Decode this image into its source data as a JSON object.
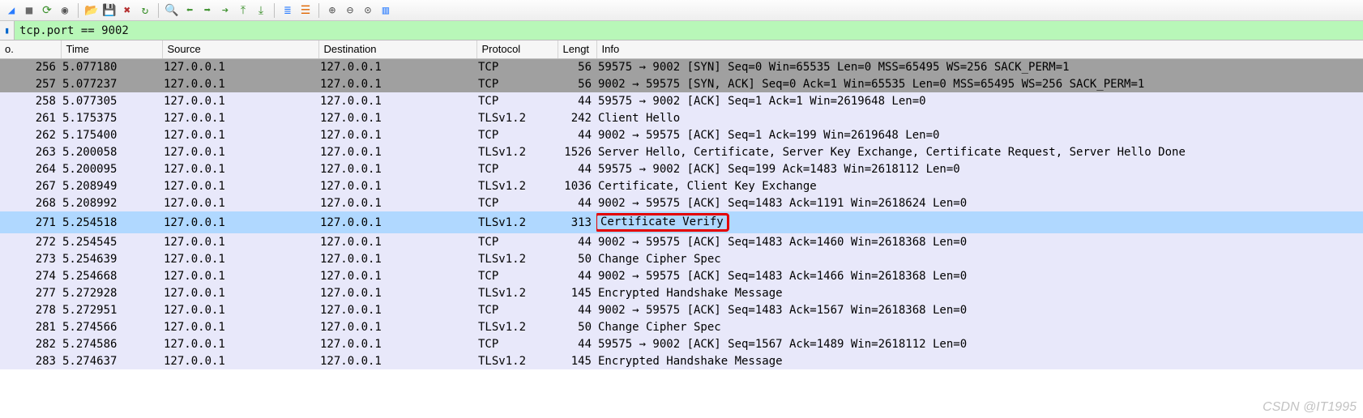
{
  "filter": {
    "value": "tcp.port == 9002",
    "bookmark_glyph": "▮"
  },
  "toolbar_icons": [
    {
      "name": "start-capture-icon",
      "glyph": "◢",
      "color": "#2a7cff"
    },
    {
      "name": "stop-capture-icon",
      "glyph": "■",
      "color": "#6a6a6a"
    },
    {
      "name": "restart-capture-icon",
      "glyph": "⟳",
      "color": "#3a8f2a"
    },
    {
      "name": "options-icon",
      "glyph": "◉",
      "color": "#555"
    },
    {
      "name": "sep"
    },
    {
      "name": "open-file-icon",
      "glyph": "📂",
      "color": "#caa012"
    },
    {
      "name": "save-file-icon",
      "glyph": "💾",
      "color": "#3260b4"
    },
    {
      "name": "close-file-icon",
      "glyph": "✖",
      "color": "#b53030"
    },
    {
      "name": "reload-icon",
      "glyph": "↻",
      "color": "#3a8f2a"
    },
    {
      "name": "sep"
    },
    {
      "name": "find-packet-icon",
      "glyph": "🔍",
      "color": "#555"
    },
    {
      "name": "go-back-icon",
      "glyph": "⬅",
      "color": "#3a8f2a"
    },
    {
      "name": "go-forward-icon",
      "glyph": "➡",
      "color": "#3a8f2a"
    },
    {
      "name": "goto-packet-icon",
      "glyph": "➔",
      "color": "#3a8f2a"
    },
    {
      "name": "first-packet-icon",
      "glyph": "⤒",
      "color": "#3a8f2a"
    },
    {
      "name": "last-packet-icon",
      "glyph": "⤓",
      "color": "#3a8f2a"
    },
    {
      "name": "sep"
    },
    {
      "name": "auto-scroll-icon",
      "glyph": "≣",
      "color": "#2a7cff"
    },
    {
      "name": "colorize-icon",
      "glyph": "☰",
      "color": "#e06500"
    },
    {
      "name": "sep"
    },
    {
      "name": "zoom-in-icon",
      "glyph": "⊕",
      "color": "#555"
    },
    {
      "name": "zoom-out-icon",
      "glyph": "⊖",
      "color": "#555"
    },
    {
      "name": "zoom-reset-icon",
      "glyph": "⊙",
      "color": "#555"
    },
    {
      "name": "resize-columns-icon",
      "glyph": "▥",
      "color": "#2a7cff"
    }
  ],
  "columns": [
    "o.",
    "Time",
    "Source",
    "Destination",
    "Protocol",
    "Lengt",
    "Info"
  ],
  "rows": [
    {
      "no": "256",
      "time": "5.077180",
      "src": "127.0.0.1",
      "dst": "127.0.0.1",
      "proto": "TCP",
      "len": "56",
      "info": "59575 → 9002 [SYN] Seq=0 Win=65535 Len=0 MSS=65495 WS=256 SACK_PERM=1",
      "cls": "syn"
    },
    {
      "no": "257",
      "time": "5.077237",
      "src": "127.0.0.1",
      "dst": "127.0.0.1",
      "proto": "TCP",
      "len": "56",
      "info": "9002 → 59575 [SYN, ACK] Seq=0 Ack=1 Win=65535 Len=0 MSS=65495 WS=256 SACK_PERM=1",
      "cls": "syn"
    },
    {
      "no": "258",
      "time": "5.077305",
      "src": "127.0.0.1",
      "dst": "127.0.0.1",
      "proto": "TCP",
      "len": "44",
      "info": "59575 → 9002 [ACK] Seq=1 Ack=1 Win=2619648 Len=0",
      "cls": "tcp"
    },
    {
      "no": "261",
      "time": "5.175375",
      "src": "127.0.0.1",
      "dst": "127.0.0.1",
      "proto": "TLSv1.2",
      "len": "242",
      "info": "Client Hello",
      "cls": "tcp"
    },
    {
      "no": "262",
      "time": "5.175400",
      "src": "127.0.0.1",
      "dst": "127.0.0.1",
      "proto": "TCP",
      "len": "44",
      "info": "9002 → 59575 [ACK] Seq=1 Ack=199 Win=2619648 Len=0",
      "cls": "tcp"
    },
    {
      "no": "263",
      "time": "5.200058",
      "src": "127.0.0.1",
      "dst": "127.0.0.1",
      "proto": "TLSv1.2",
      "len": "1526",
      "info": "Server Hello, Certificate, Server Key Exchange, Certificate Request, Server Hello Done",
      "cls": "tcp"
    },
    {
      "no": "264",
      "time": "5.200095",
      "src": "127.0.0.1",
      "dst": "127.0.0.1",
      "proto": "TCP",
      "len": "44",
      "info": "59575 → 9002 [ACK] Seq=199 Ack=1483 Win=2618112 Len=0",
      "cls": "tcp"
    },
    {
      "no": "267",
      "time": "5.208949",
      "src": "127.0.0.1",
      "dst": "127.0.0.1",
      "proto": "TLSv1.2",
      "len": "1036",
      "info": "Certificate, Client Key Exchange",
      "cls": "tcp"
    },
    {
      "no": "268",
      "time": "5.208992",
      "src": "127.0.0.1",
      "dst": "127.0.0.1",
      "proto": "TCP",
      "len": "44",
      "info": "9002 → 59575 [ACK] Seq=1483 Ack=1191 Win=2618624 Len=0",
      "cls": "tcp"
    },
    {
      "no": "271",
      "time": "5.254518",
      "src": "127.0.0.1",
      "dst": "127.0.0.1",
      "proto": "TLSv1.2",
      "len": "313",
      "info": "Certificate Verify",
      "cls": "selected",
      "highlight": true
    },
    {
      "no": "272",
      "time": "5.254545",
      "src": "127.0.0.1",
      "dst": "127.0.0.1",
      "proto": "TCP",
      "len": "44",
      "info": "9002 → 59575 [ACK] Seq=1483 Ack=1460 Win=2618368 Len=0",
      "cls": "tcp"
    },
    {
      "no": "273",
      "time": "5.254639",
      "src": "127.0.0.1",
      "dst": "127.0.0.1",
      "proto": "TLSv1.2",
      "len": "50",
      "info": "Change Cipher Spec",
      "cls": "tcp"
    },
    {
      "no": "274",
      "time": "5.254668",
      "src": "127.0.0.1",
      "dst": "127.0.0.1",
      "proto": "TCP",
      "len": "44",
      "info": "9002 → 59575 [ACK] Seq=1483 Ack=1466 Win=2618368 Len=0",
      "cls": "tcp"
    },
    {
      "no": "277",
      "time": "5.272928",
      "src": "127.0.0.1",
      "dst": "127.0.0.1",
      "proto": "TLSv1.2",
      "len": "145",
      "info": "Encrypted Handshake Message",
      "cls": "tcp"
    },
    {
      "no": "278",
      "time": "5.272951",
      "src": "127.0.0.1",
      "dst": "127.0.0.1",
      "proto": "TCP",
      "len": "44",
      "info": "9002 → 59575 [ACK] Seq=1483 Ack=1567 Win=2618368 Len=0",
      "cls": "tcp"
    },
    {
      "no": "281",
      "time": "5.274566",
      "src": "127.0.0.1",
      "dst": "127.0.0.1",
      "proto": "TLSv1.2",
      "len": "50",
      "info": "Change Cipher Spec",
      "cls": "tcp"
    },
    {
      "no": "282",
      "time": "5.274586",
      "src": "127.0.0.1",
      "dst": "127.0.0.1",
      "proto": "TCP",
      "len": "44",
      "info": "59575 → 9002 [ACK] Seq=1567 Ack=1489 Win=2618112 Len=0",
      "cls": "tcp"
    },
    {
      "no": "283",
      "time": "5.274637",
      "src": "127.0.0.1",
      "dst": "127.0.0.1",
      "proto": "TLSv1.2",
      "len": "145",
      "info": "Encrypted Handshake Message",
      "cls": "tcp"
    }
  ],
  "watermark": "CSDN @IT1995"
}
